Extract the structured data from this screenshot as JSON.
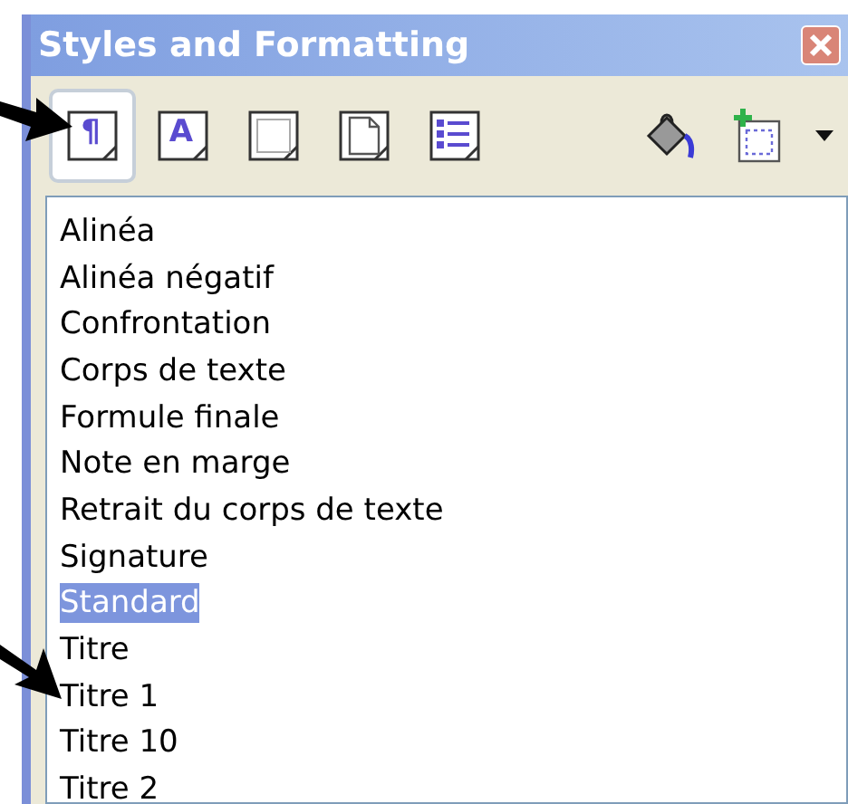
{
  "window": {
    "title": "Styles and Formatting"
  },
  "toolbar": {
    "families": [
      {
        "kind": "paragraph",
        "glyph": "¶",
        "selected": true
      },
      {
        "kind": "character",
        "glyph": "A",
        "selected": false
      },
      {
        "kind": "frame",
        "selected": false
      },
      {
        "kind": "page",
        "selected": false
      },
      {
        "kind": "list",
        "selected": false
      }
    ]
  },
  "styles": [
    {
      "label": "Alinéa",
      "selected": false
    },
    {
      "label": "Alinéa négatif",
      "selected": false
    },
    {
      "label": "Confrontation",
      "selected": false
    },
    {
      "label": "Corps de texte",
      "selected": false
    },
    {
      "label": "Formule finale",
      "selected": false
    },
    {
      "label": "Note en marge",
      "selected": false
    },
    {
      "label": "Retrait du corps de texte",
      "selected": false
    },
    {
      "label": "Signature",
      "selected": false
    },
    {
      "label": "Standard",
      "selected": true
    },
    {
      "label": "Titre",
      "selected": false
    },
    {
      "label": "Titre 1",
      "selected": false
    },
    {
      "label": "Titre 10",
      "selected": false
    },
    {
      "label": "Titre 2",
      "selected": false
    }
  ]
}
